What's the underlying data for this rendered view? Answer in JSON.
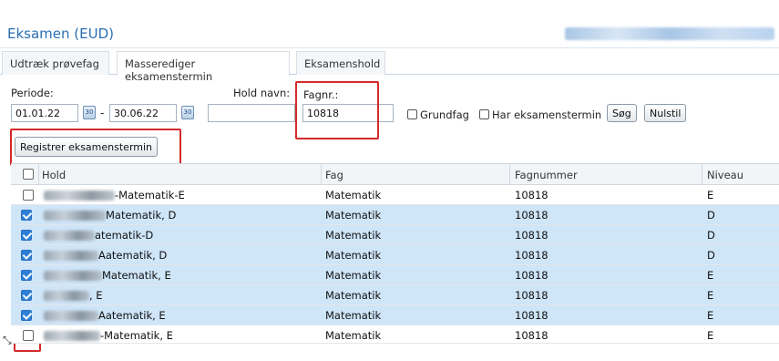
{
  "app": {
    "title": "Eksamen (EUD)"
  },
  "tabs": [
    {
      "label": "Udtræk prøvefag",
      "active": false
    },
    {
      "label": "Masserediger eksamenstermin",
      "active": true
    },
    {
      "label": "Eksamenshold",
      "active": false
    }
  ],
  "filters": {
    "periode_label": "Periode:",
    "date_from": "01.01.22",
    "date_sep": "-",
    "date_to": "30.06.22",
    "hold_navn_label": "Hold navn:",
    "hold_navn_value": "",
    "fagnr_label": "Fagnr.:",
    "fagnr_value": "10818",
    "grundfag_label": "Grundfag",
    "har_eksamenstermin_label": "Har eksamenstermin",
    "search_label": "Søg",
    "reset_label": "Nulstil",
    "register_label": "Registrer eksamenstermin"
  },
  "table": {
    "headers": [
      "Hold",
      "Fag",
      "Fagnummer",
      "Niveau"
    ],
    "rows": [
      {
        "hold_suffix": "-Matematik-E",
        "fag": "Matematik",
        "fagnummer": "10818",
        "niveau": "E",
        "checked": false
      },
      {
        "hold_suffix": "Matematik, D",
        "fag": "Matematik",
        "fagnummer": "10818",
        "niveau": "D",
        "checked": true
      },
      {
        "hold_suffix": "atematik-D",
        "fag": "Matematik",
        "fagnummer": "10818",
        "niveau": "D",
        "checked": true
      },
      {
        "hold_suffix": "Aatematik, D",
        "fag": "Matematik",
        "fagnummer": "10818",
        "niveau": "D",
        "checked": true
      },
      {
        "hold_suffix": "Matematik, E",
        "fag": "Matematik",
        "fagnummer": "10818",
        "niveau": "E",
        "checked": true
      },
      {
        "hold_suffix": ", E",
        "fag": "Matematik",
        "fagnummer": "10818",
        "niveau": "E",
        "checked": true
      },
      {
        "hold_suffix": "Aatematik, E",
        "fag": "Matematik",
        "fagnummer": "10818",
        "niveau": "E",
        "checked": true
      },
      {
        "hold_suffix": "-Matematik, E",
        "fag": "Matematik",
        "fagnummer": "10818",
        "niveau": "E",
        "checked": false
      }
    ]
  },
  "colors": {
    "accent": "#2a6fb0",
    "highlight": "#d42a2a",
    "selected_row": "#cfe5f8"
  }
}
